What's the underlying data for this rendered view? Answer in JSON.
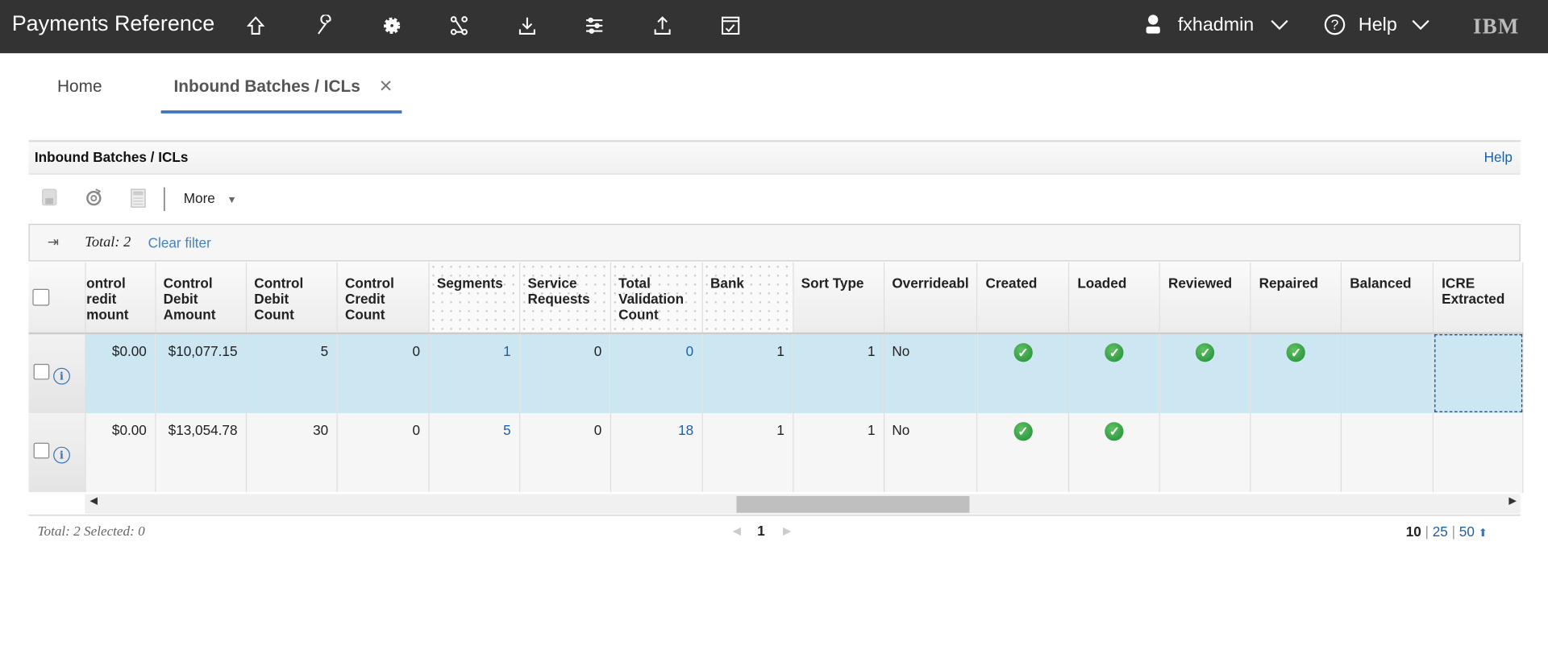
{
  "app": {
    "title": "Payments Reference",
    "user": "fxhadmin",
    "help": "Help",
    "logo": "IBM"
  },
  "nav_icons": [
    "home-icon",
    "wrench-icon",
    "gear-icon",
    "workflow-icon",
    "download-icon",
    "sliders-icon",
    "upload-icon",
    "dashboard-icon"
  ],
  "tabs": [
    {
      "label": "Home"
    },
    {
      "label": "Inbound Batches / ICLs"
    }
  ],
  "panel": {
    "title": "Inbound Batches / ICLs",
    "help": "Help"
  },
  "toolbar": {
    "more": "More"
  },
  "filter": {
    "total": "Total: 2",
    "clear": "Clear filter"
  },
  "columns": [
    "ontrol redit mount",
    "Control Debit Amount",
    "Control Debit Count",
    "Control Credit Count",
    "Segments",
    "Service Requests",
    "Total Validation Count",
    "Bank",
    "Sort Type",
    "Overrideabl",
    "Created",
    "Loaded",
    "Reviewed",
    "Repaired",
    "Balanced",
    "ICRE Extracted"
  ],
  "rows": [
    {
      "credit_amount": "$0.00",
      "debit_amount": "$10,077.15",
      "debit_count": "5",
      "credit_count": "0",
      "segments": "1",
      "service_requests": "0",
      "total_validation": "0",
      "bank": "1",
      "sort_type": "1",
      "overrideable": "No",
      "created": true,
      "loaded": true,
      "reviewed": true,
      "repaired": true,
      "balanced": false,
      "icre": false
    },
    {
      "credit_amount": "$0.00",
      "debit_amount": "$13,054.78",
      "debit_count": "30",
      "credit_count": "0",
      "segments": "5",
      "service_requests": "0",
      "total_validation": "18",
      "bank": "1",
      "sort_type": "1",
      "overrideable": "No",
      "created": true,
      "loaded": true,
      "reviewed": false,
      "repaired": false,
      "balanced": false,
      "icre": false
    }
  ],
  "footer": {
    "summary": "Total: 2 Selected: 0",
    "page": "1",
    "sizes": [
      "10",
      "25",
      "50"
    ]
  },
  "colors": {
    "topbar": "#333333",
    "accent": "#3b73b9",
    "selected_row": "#cde7f2",
    "ok": "#1f8a3a"
  }
}
